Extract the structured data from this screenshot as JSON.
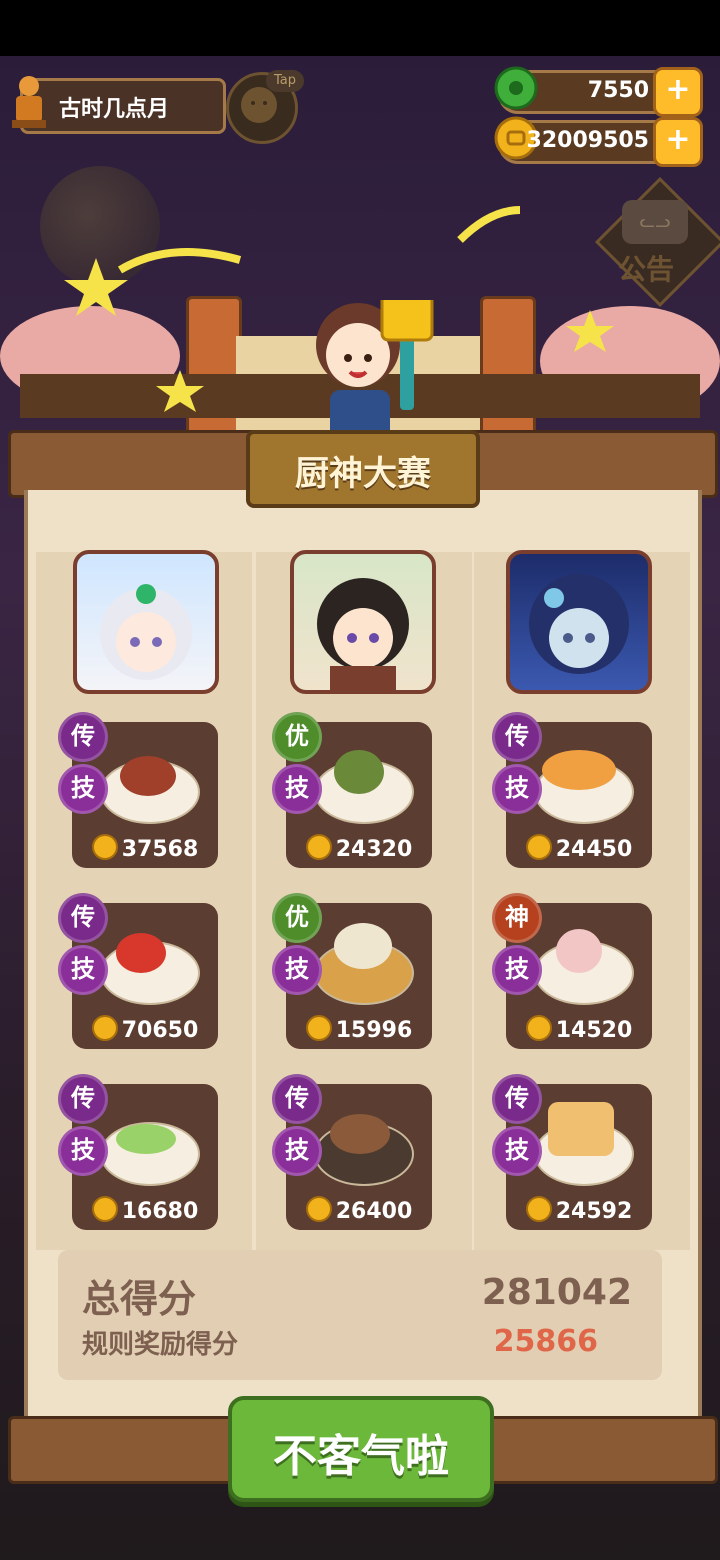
{
  "player": {
    "name": "古时几点月",
    "tap_label": "Tap"
  },
  "resources": {
    "jade": "7550",
    "coins": "32009505"
  },
  "notice": {
    "label": "公告"
  },
  "contest": {
    "title": "厨神大赛"
  },
  "columns": [
    {
      "chef": "chef-1",
      "dishes": [
        {
          "rarity": "传",
          "skill": "技",
          "score": "37568"
        },
        {
          "rarity": "传",
          "skill": "技",
          "score": "70650"
        },
        {
          "rarity": "传",
          "skill": "技",
          "score": "16680"
        }
      ]
    },
    {
      "chef": "chef-2",
      "dishes": [
        {
          "rarity": "优",
          "skill": "技",
          "score": "24320"
        },
        {
          "rarity": "优",
          "skill": "技",
          "score": "15996"
        },
        {
          "rarity": "传",
          "skill": "技",
          "score": "26400"
        }
      ]
    },
    {
      "chef": "chef-3",
      "dishes": [
        {
          "rarity": "传",
          "skill": "技",
          "score": "24450"
        },
        {
          "rarity": "神",
          "skill": "技",
          "score": "14520"
        },
        {
          "rarity": "传",
          "skill": "技",
          "score": "24592"
        }
      ]
    }
  ],
  "summary": {
    "total_label": "总得分",
    "total_value": "281042",
    "bonus_label": "规则奖励得分",
    "bonus_value": "25866"
  },
  "confirm_button": "不客气啦",
  "colors": {
    "legendary": "#7a2a8a",
    "excellent": "#4e8d2a",
    "divine": "#b5411e",
    "bonus": "#e0664a"
  }
}
